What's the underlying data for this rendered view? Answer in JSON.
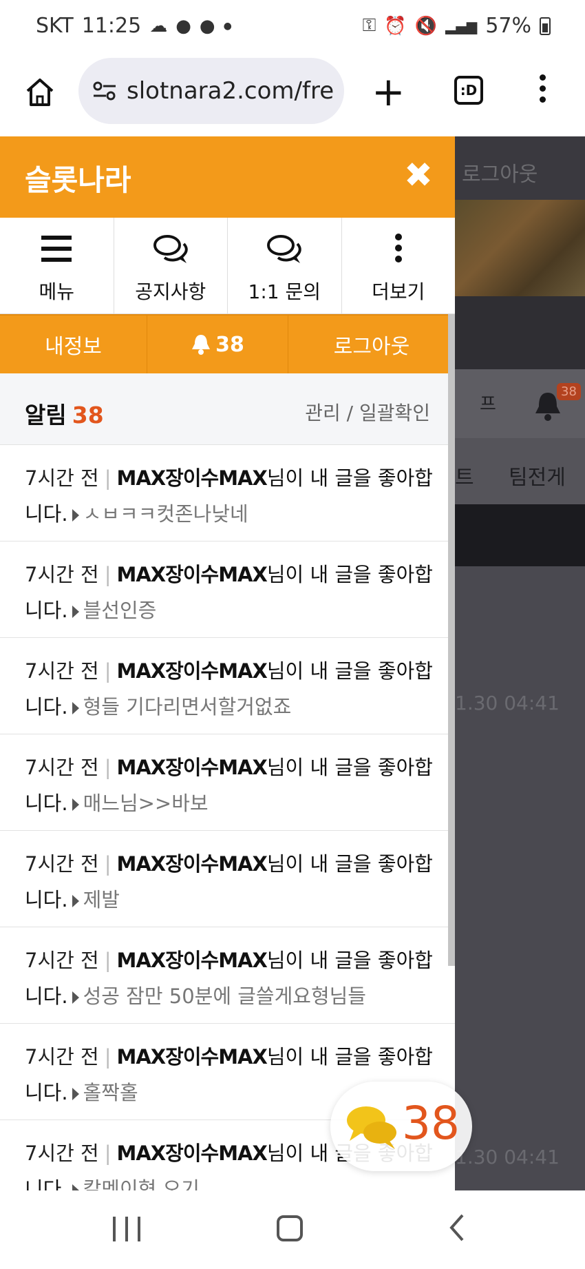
{
  "status_bar": {
    "carrier": "SKT",
    "time": "11:25",
    "battery": "57%"
  },
  "browser": {
    "url": "slotnara2.com/fre",
    "tabs_label": ":D"
  },
  "drawer": {
    "title": "슬롯나라",
    "quick_menu": [
      {
        "label": "메뉴",
        "icon": "hamburger-icon"
      },
      {
        "label": "공지사항",
        "icon": "chat-bubbles-icon"
      },
      {
        "label": "1:1 문의",
        "icon": "chat-bubbles-icon"
      },
      {
        "label": "더보기",
        "icon": "vertical-dots-icon"
      }
    ],
    "actions": {
      "my_info": "내정보",
      "bell_count": "38",
      "logout": "로그아웃"
    },
    "alerts": {
      "title": "알림",
      "count": "38",
      "manage": "관리 / 일괄확인"
    },
    "notifications": [
      {
        "time": "7시간 전",
        "user": "MAX장이수MAX",
        "message": "님이 내 글을 좋아합니다.",
        "post": "ㅅㅂㅋㅋ컷존나낮네"
      },
      {
        "time": "7시간 전",
        "user": "MAX장이수MAX",
        "message": "님이 내 글을 좋아합니다.",
        "post": "블선인증"
      },
      {
        "time": "7시간 전",
        "user": "MAX장이수MAX",
        "message": "님이 내 글을 좋아합니다.",
        "post": "형들 기다리면서할거없죠"
      },
      {
        "time": "7시간 전",
        "user": "MAX장이수MAX",
        "message": "님이 내 글을 좋아합니다.",
        "post": "매느님>>바보"
      },
      {
        "time": "7시간 전",
        "user": "MAX장이수MAX",
        "message": "님이 내 글을 좋아합니다.",
        "post": "제발"
      },
      {
        "time": "7시간 전",
        "user": "MAX장이수MAX",
        "message": "님이 내 글을 좋아합니다.",
        "post": "성공 잠만 50분에 글쓸게요형님들"
      },
      {
        "time": "7시간 전",
        "user": "MAX장이수MAX",
        "message": "님이 내 글을 좋아합니다.",
        "post": "홀짝홀"
      },
      {
        "time": "7시간 전",
        "user": "MAX장이수MAX",
        "message": "님이 내 글을 좋아합니다.",
        "post": "칼멘이형 오기"
      }
    ]
  },
  "background_page": {
    "header_text": "로그아웃",
    "tab_p": "프",
    "bell_badge": "38",
    "menu_1": "트",
    "menu_2": "팀전게",
    "date_1": "1.30 04:41",
    "date_2": "1.30 04:41"
  },
  "floating_chat": {
    "count": "38"
  },
  "colors": {
    "accent": "#f39a1a",
    "count_red": "#e2561d"
  }
}
